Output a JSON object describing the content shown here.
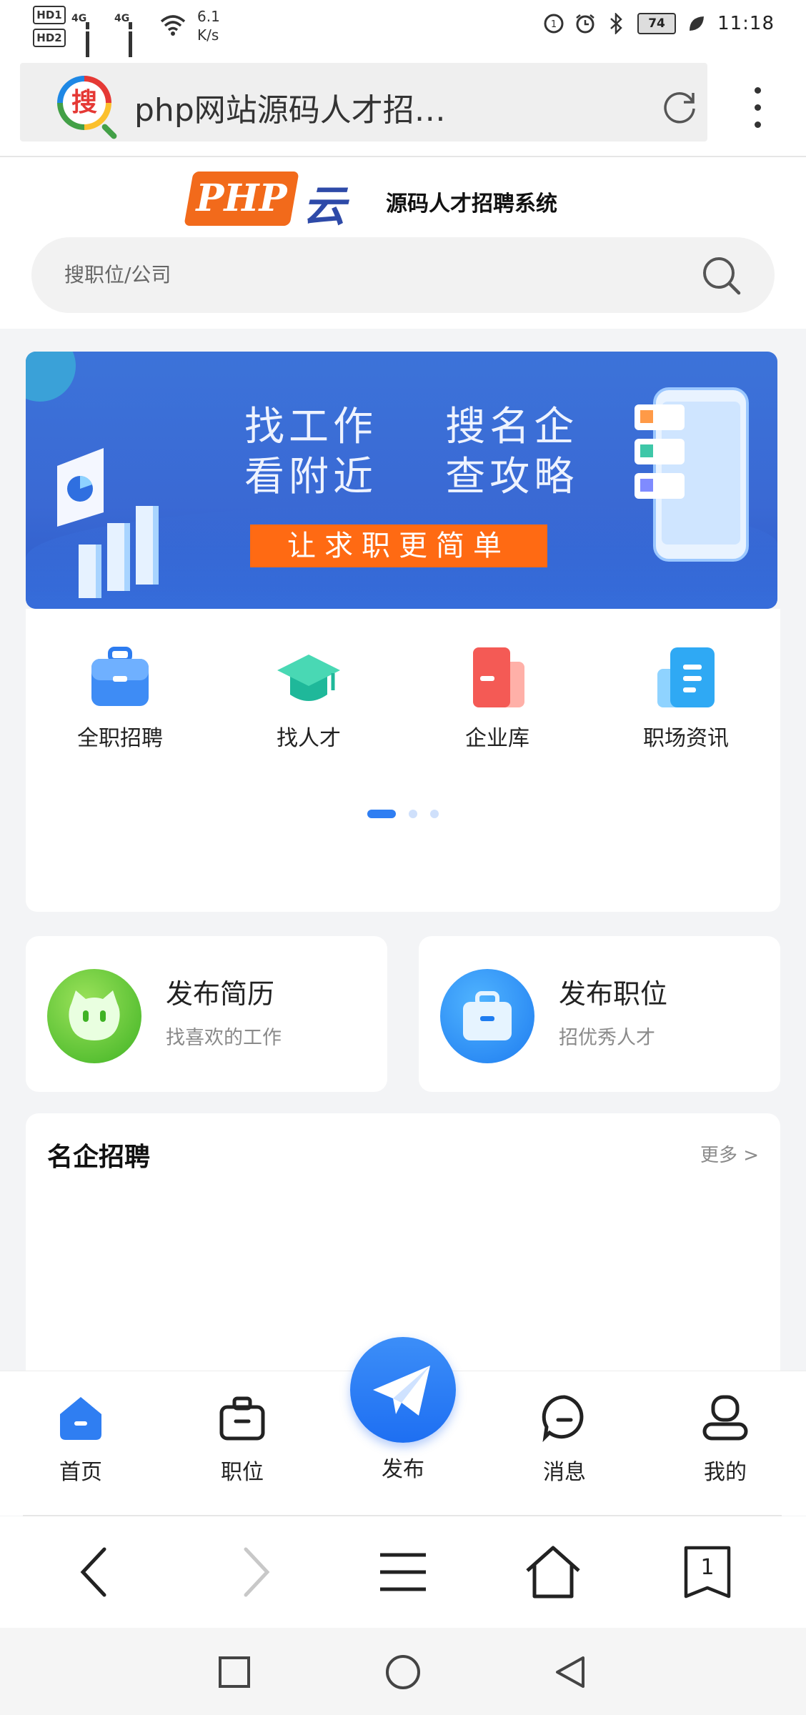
{
  "status_bar": {
    "hd1": "HD1",
    "hd2": "HD2",
    "net1": "4G",
    "net2": "4G",
    "speed_value": "6.1",
    "speed_unit": "K/s",
    "battery": "74",
    "time": "11:18"
  },
  "browser": {
    "page_title": "php网站源码人才招…",
    "logo_char": "搜"
  },
  "site_header": {
    "logo_text": "PHP",
    "logo_cloud": "云",
    "slogan": "源码人才招聘系统",
    "search_placeholder": "搜职位/公司"
  },
  "banner": {
    "line1": "找工作    搜名企",
    "line2": "看附近    查攻略",
    "cta": "让求职更简单"
  },
  "nav": {
    "items": [
      {
        "label": "全职招聘",
        "icon": "briefcase-icon"
      },
      {
        "label": "找人才",
        "icon": "graduation-cap-icon"
      },
      {
        "label": "企业库",
        "icon": "company-card-icon"
      },
      {
        "label": "职场资讯",
        "icon": "news-icon"
      }
    ],
    "pages": 3,
    "active_page": 0
  },
  "publish": {
    "resume_title": "发布简历",
    "resume_sub": "找喜欢的工作",
    "job_title": "发布职位",
    "job_sub": "招优秀人才"
  },
  "famous": {
    "title": "名企招聘",
    "more": "更多 >"
  },
  "tabbar": {
    "items": [
      {
        "label": "首页",
        "active": true
      },
      {
        "label": "职位",
        "active": false
      },
      {
        "label": "发布",
        "active": false
      },
      {
        "label": "消息",
        "active": false
      },
      {
        "label": "我的",
        "active": false
      }
    ]
  },
  "browser_nav": {
    "tab_count": "1"
  },
  "colors": {
    "accent": "#2f7ef2",
    "cta_orange": "#ff6a13",
    "logo_orange": "#f26a1b",
    "banner_blue": "#3a69d4"
  }
}
